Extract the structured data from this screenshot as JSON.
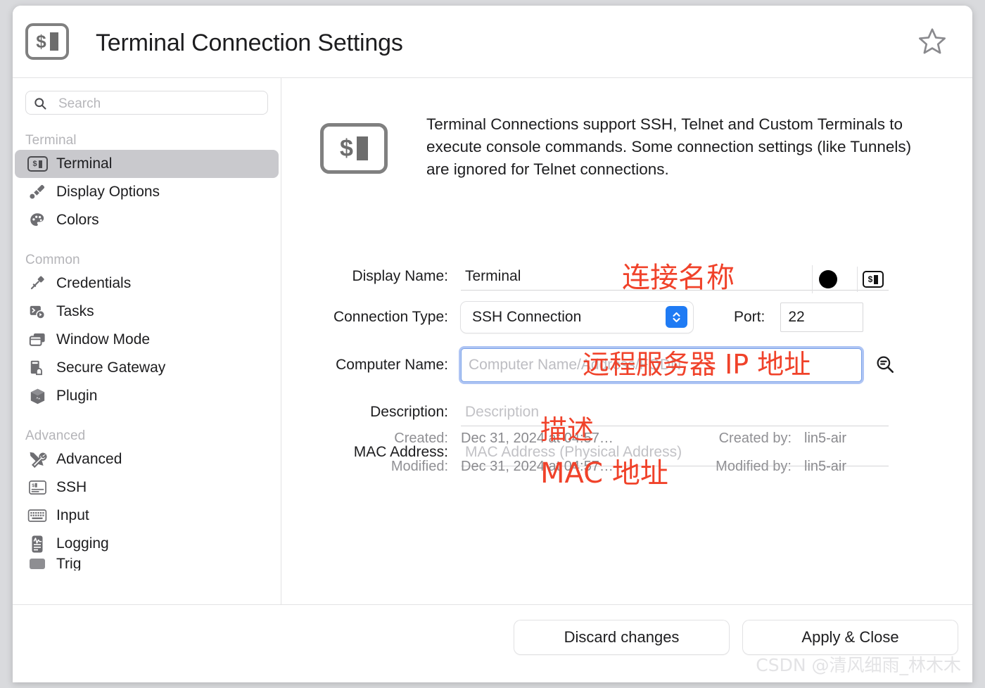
{
  "window": {
    "title": "Terminal Connection Settings",
    "title_icon": "terminal-icon",
    "favorite_icon": "star-outline-icon"
  },
  "sidebar": {
    "search": {
      "placeholder": "Search",
      "value": "",
      "icon": "search-icon"
    },
    "groups": [
      {
        "label": "Terminal",
        "items": [
          {
            "label": "Terminal",
            "icon": "terminal-icon",
            "selected": true
          },
          {
            "label": "Display Options",
            "icon": "paint-brush-icon",
            "selected": false
          },
          {
            "label": "Colors",
            "icon": "color-palette-icon",
            "selected": false
          }
        ]
      },
      {
        "label": "Common",
        "items": [
          {
            "label": "Credentials",
            "icon": "key-icon",
            "selected": false
          },
          {
            "label": "Tasks",
            "icon": "console-play-icon",
            "selected": false
          },
          {
            "label": "Window Mode",
            "icon": "windows-icon",
            "selected": false
          },
          {
            "label": "Secure Gateway",
            "icon": "secure-gateway-icon",
            "selected": false
          },
          {
            "label": "Plugin",
            "icon": "cube-icon",
            "selected": false
          }
        ]
      },
      {
        "label": "Advanced",
        "items": [
          {
            "label": "Advanced",
            "icon": "tools-icon",
            "selected": false
          },
          {
            "label": "SSH",
            "icon": "ssh-terminal-icon",
            "selected": false
          },
          {
            "label": "Input",
            "icon": "keyboard-icon",
            "selected": false
          },
          {
            "label": "Logging",
            "icon": "logging-icon",
            "selected": false
          }
        ]
      }
    ]
  },
  "main": {
    "intro_icon": "terminal-icon",
    "intro_text": "Terminal Connections support SSH, Telnet and Custom Terminals to execute console commands. Some connection settings (like Tunnels) are ignored for Telnet connections.",
    "fields": {
      "display_name": {
        "label": "Display Name:",
        "value": "Terminal",
        "placeholder": "",
        "swatch_color": "#000000",
        "swatch_icon": "color-swatch-icon",
        "terminal_button_icon": "terminal-icon"
      },
      "connection_type": {
        "label": "Connection Type:",
        "value": "SSH Connection",
        "stepper_icon": "chevron-up-down-icon",
        "stepper_color": "#1f7bf4"
      },
      "port": {
        "label": "Port:",
        "value": "22"
      },
      "computer_name": {
        "label": "Computer Name:",
        "value": "",
        "placeholder": "Computer Name/Address/FQDN",
        "focused": true,
        "browse_icon": "browse-search-icon"
      },
      "description": {
        "label": "Description:",
        "value": "",
        "placeholder": "Description"
      },
      "mac_address": {
        "label": "MAC Address:",
        "value": "",
        "placeholder": "MAC Address (Physical Address)"
      }
    },
    "meta": {
      "created_label": "Created:",
      "created_value": "Dec 31, 2024 at 04:57…",
      "created_by_label": "Created by:",
      "created_by_value": "lin5-air",
      "modified_label": "Modified:",
      "modified_value": "Dec 31, 2024 at 04:57…",
      "modified_by_label": "Modified by:",
      "modified_by_value": "lin5-air"
    }
  },
  "footer": {
    "discard_label": "Discard changes",
    "apply_label": "Apply & Close"
  },
  "annotations": {
    "color": "#f0422a",
    "display_name": "连接名称",
    "computer_name": "远程服务器 IP 地址",
    "description": "描述",
    "mac_address": "MAC 地址"
  },
  "watermark": "CSDN @清风细雨_林木木"
}
